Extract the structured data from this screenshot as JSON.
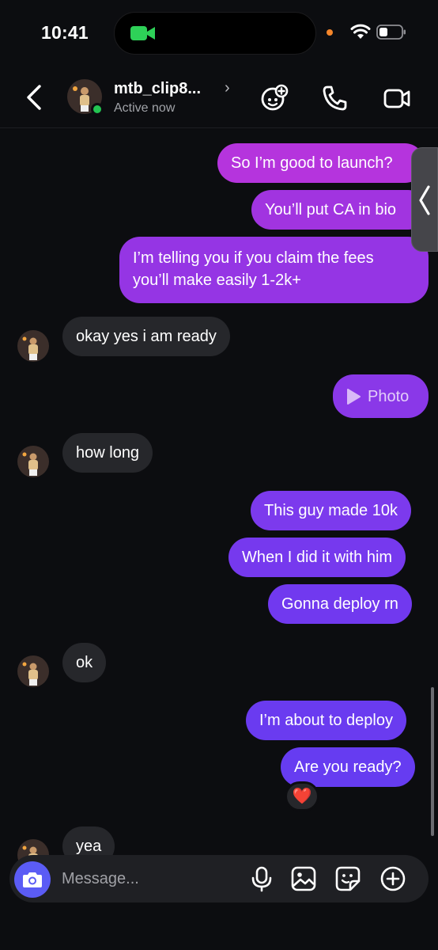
{
  "status_bar": {
    "time": "10:41"
  },
  "header": {
    "name": "mtb_clip8...",
    "status": "Active now"
  },
  "messages": [
    {
      "text": "So I’m good to launch?"
    },
    {
      "text": "You’ll put CA in bio"
    },
    {
      "text": "I’m telling you if you claim the fees"
    },
    {
      "text": "you’ll make easily 1-2k+"
    },
    {
      "text": "okay yes i am ready"
    },
    {
      "text": "Photo"
    },
    {
      "text": "how long"
    },
    {
      "text": "This guy made 10k"
    },
    {
      "text": "When I did it with him"
    },
    {
      "text": "Gonna deploy rn"
    },
    {
      "text": "ok"
    },
    {
      "text": "I’m about to deploy"
    },
    {
      "text": "Are you ready?"
    },
    {
      "text": "yea"
    }
  ],
  "reaction": "❤️",
  "composer": {
    "placeholder": "Message..."
  },
  "colors": {
    "accent": "#5b5cf5",
    "bubble_incoming": "#26272b",
    "bubble_purple": "#a433d8",
    "bubble_violet": "#6f3bf0",
    "online": "#23c552"
  }
}
